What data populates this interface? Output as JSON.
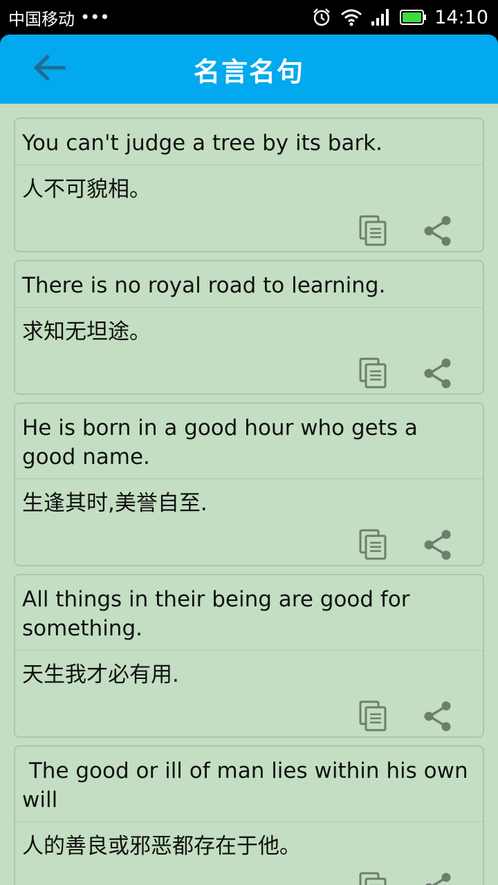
{
  "status": {
    "carrier": "中国移动",
    "dots": "•••",
    "time": "14:10"
  },
  "header": {
    "title": "名言名句",
    "back_icon": "arrow-left-icon"
  },
  "quotes": [
    {
      "en": "You can't judge a tree by its bark.",
      "zh": "人不可貌相。"
    },
    {
      "en": "There is no royal road to learning.",
      "zh": "求知无坦途。"
    },
    {
      "en": "He is born in a good hour who gets a good name.",
      "zh": "生逢其时,美誉自至."
    },
    {
      "en": "All things in their being are good for something.",
      "zh": "天生我才必有用."
    },
    {
      "en": " The good or ill of man lies within his own will",
      "zh": "人的善良或邪恶都存在于他。"
    }
  ],
  "colors": {
    "appbar": "#03A9EE",
    "background": "#C3DEC2",
    "card_border": "#ABC6AA",
    "icon": "#6E7D6E"
  }
}
